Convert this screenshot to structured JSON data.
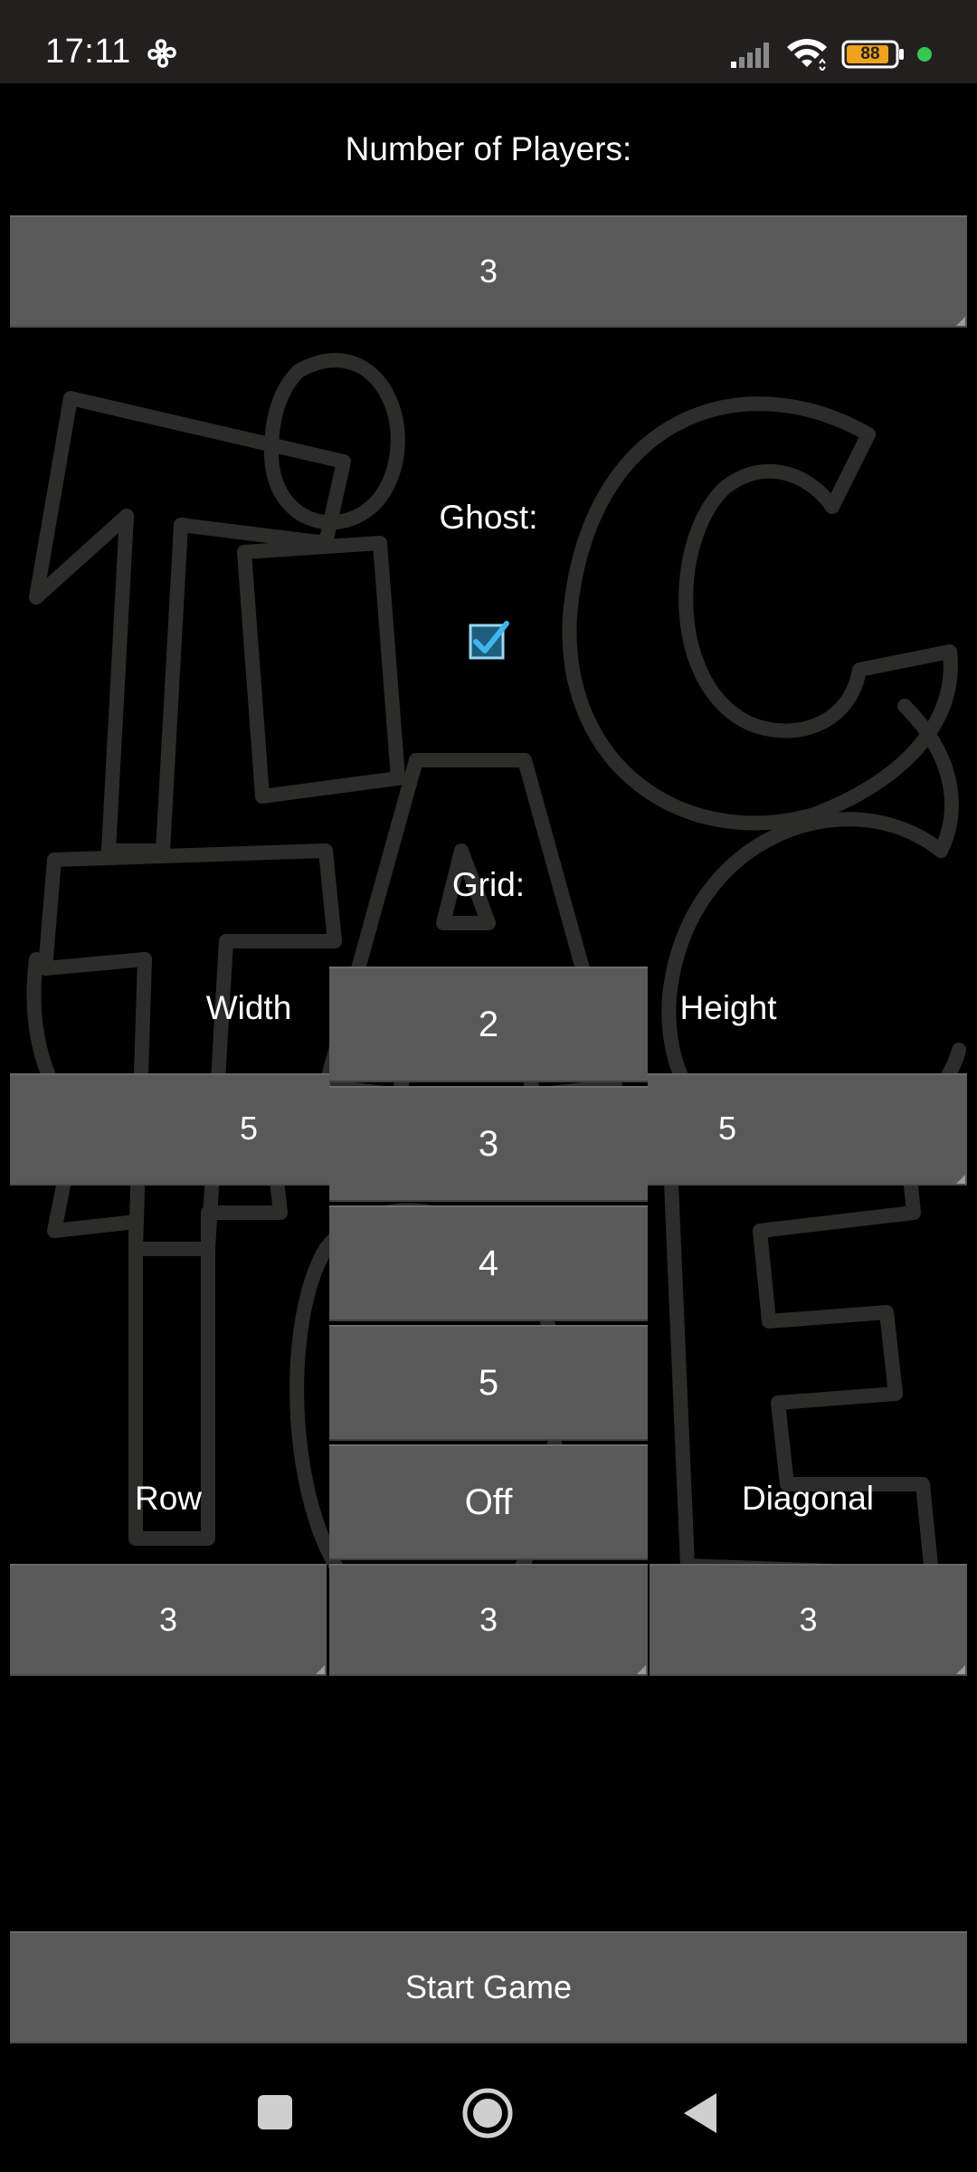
{
  "status_bar": {
    "time": "17:11",
    "battery": "88",
    "icons": [
      "fan-icon",
      "signal-icon",
      "wifi-icon",
      "battery-icon",
      "privacy-dot-icon"
    ]
  },
  "players": {
    "label": "Number of Players:",
    "value": "3"
  },
  "ghost": {
    "label": "Ghost:",
    "checked": true
  },
  "grid": {
    "label": "Grid:",
    "width_label": "Width",
    "width_value": "5",
    "height_label": "Height",
    "height_value": "5",
    "options": [
      "2",
      "3",
      "4",
      "5",
      "Off"
    ]
  },
  "win_conditions": {
    "row_label": "Row",
    "row_value": "3",
    "column_value": "3",
    "diagonal_label": "Diagonal",
    "diagonal_value": "3"
  },
  "start_button": "Start Game",
  "nav": {
    "icons": [
      "recents-icon",
      "home-icon",
      "back-icon"
    ]
  },
  "colors": {
    "background": "#000000",
    "field": "#595959",
    "status_bar": "#221f1f",
    "accent_check": "#2aa7e0",
    "battery_fill": "#f0a21c",
    "dot": "#35c94f",
    "art_stroke": "#2c2c2a"
  }
}
